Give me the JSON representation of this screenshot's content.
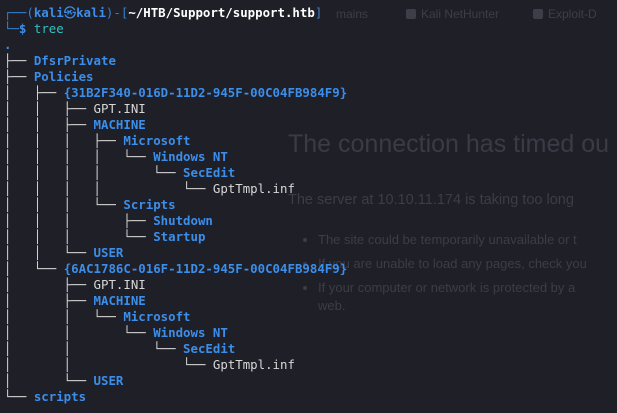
{
  "background_page": {
    "bookmarks": [
      "mains",
      "Kali NetHunter",
      "Exploit-D"
    ],
    "error_title": "The connection has timed ou",
    "error_subtitle": "The server at 10.10.11.174 is taking too long",
    "bullets": [
      "The site could be temporarily unavailable or t",
      "If you are unable to load any pages, check you",
      "If your computer or network is protected by a",
      "web."
    ]
  },
  "prompt": {
    "corner_top": "┌──(",
    "user": "kali",
    "at_icon": "㉿",
    "host": "kali",
    "mid": ")-[",
    "path": "~/HTB/Support/support.htb",
    "close": "]",
    "corner_bottom": "└─",
    "dollar": "$",
    "command": "tree"
  },
  "tree": [
    {
      "prefix": "",
      "name": ".",
      "type": "dot"
    },
    {
      "prefix": "├── ",
      "name": "DfsrPrivate",
      "type": "dir"
    },
    {
      "prefix": "├── ",
      "name": "Policies",
      "type": "dir"
    },
    {
      "prefix": "│   ├── ",
      "name": "{31B2F340-016D-11D2-945F-00C04FB984F9}",
      "type": "dir"
    },
    {
      "prefix": "│   │   ├── ",
      "name": "GPT.INI",
      "type": "file"
    },
    {
      "prefix": "│   │   ├── ",
      "name": "MACHINE",
      "type": "dir"
    },
    {
      "prefix": "│   │   │   ├── ",
      "name": "Microsoft",
      "type": "dir"
    },
    {
      "prefix": "│   │   │   │   └── ",
      "name": "Windows NT",
      "type": "dir"
    },
    {
      "prefix": "│   │   │   │       └── ",
      "name": "SecEdit",
      "type": "dir"
    },
    {
      "prefix": "│   │   │   │           └── ",
      "name": "GptTmpl.inf",
      "type": "file"
    },
    {
      "prefix": "│   │   │   └── ",
      "name": "Scripts",
      "type": "dir"
    },
    {
      "prefix": "│   │   │       ├── ",
      "name": "Shutdown",
      "type": "dir"
    },
    {
      "prefix": "│   │   │       └── ",
      "name": "Startup",
      "type": "dir"
    },
    {
      "prefix": "│   │   └── ",
      "name": "USER",
      "type": "dir"
    },
    {
      "prefix": "│   └── ",
      "name": "{6AC1786C-016F-11D2-945F-00C04FB984F9}",
      "type": "dir"
    },
    {
      "prefix": "│       ├── ",
      "name": "GPT.INI",
      "type": "file"
    },
    {
      "prefix": "│       ├── ",
      "name": "MACHINE",
      "type": "dir"
    },
    {
      "prefix": "│       │   └── ",
      "name": "Microsoft",
      "type": "dir"
    },
    {
      "prefix": "│       │       └── ",
      "name": "Windows NT",
      "type": "dir"
    },
    {
      "prefix": "│       │           └── ",
      "name": "SecEdit",
      "type": "dir"
    },
    {
      "prefix": "│       │               └── ",
      "name": "GptTmpl.inf",
      "type": "file"
    },
    {
      "prefix": "│       └── ",
      "name": "USER",
      "type": "dir"
    },
    {
      "prefix": "└── ",
      "name": "scripts",
      "type": "dir"
    }
  ],
  "colors": {
    "background": "#1f1f28",
    "directory": "#3b8eea",
    "file": "#d7d7d7",
    "command": "#2fc2c2",
    "prompt_frame": "#3580d0"
  }
}
